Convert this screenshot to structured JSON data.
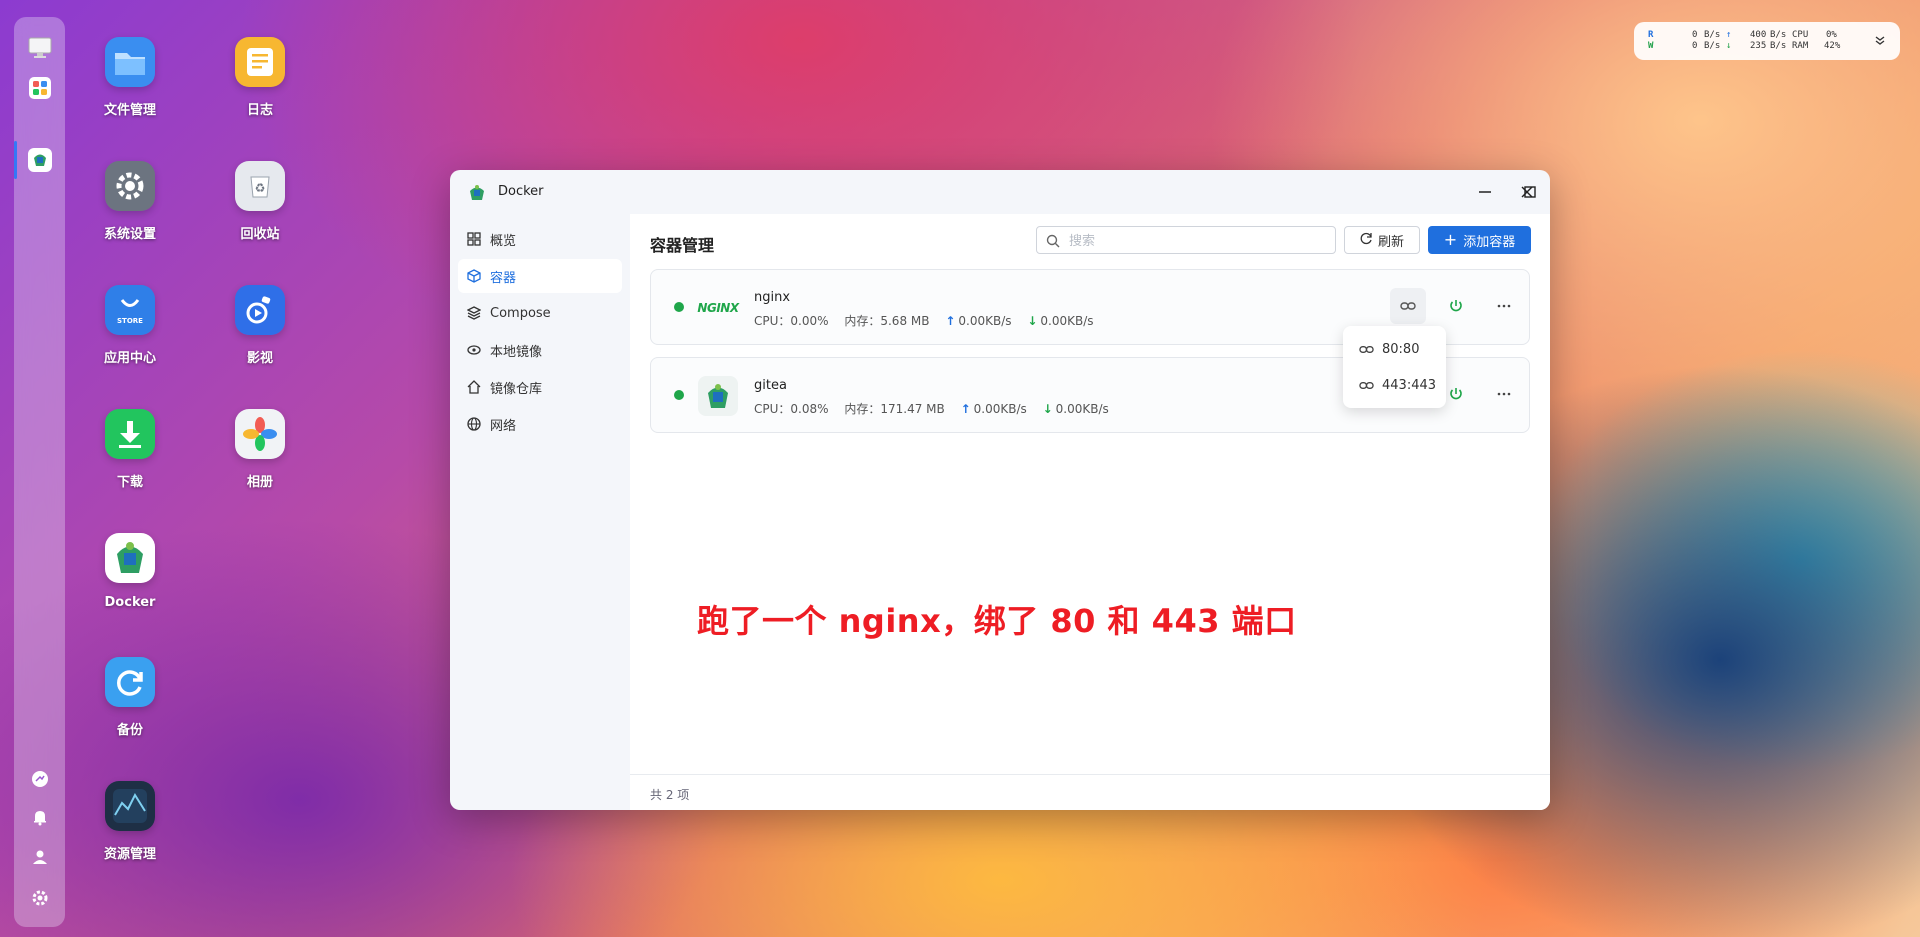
{
  "desktop": {
    "icons": [
      {
        "label": "文件管理",
        "icon": "folder-icon",
        "color": "#3a8ef0"
      },
      {
        "label": "日志",
        "icon": "log-icon",
        "color": "#f7b731"
      },
      {
        "label": "系统设置",
        "icon": "gear-icon",
        "color": "#6c7480"
      },
      {
        "label": "回收站",
        "icon": "recycle-bin-icon",
        "color": "#e6e9ee"
      },
      {
        "label": "应用中心",
        "icon": "store-icon",
        "color": "#2f7fe8"
      },
      {
        "label": "影视",
        "icon": "video-icon",
        "color": "#2f6fe8"
      },
      {
        "label": "下载",
        "icon": "download-icon",
        "color": "#22c55e"
      },
      {
        "label": "相册",
        "icon": "photos-icon",
        "color": "#f1f3f6"
      },
      {
        "label": "Docker",
        "icon": "docker-icon",
        "color": "#ffffff"
      },
      {
        "label": "备份",
        "icon": "backup-icon",
        "color": "#3aa0f0"
      },
      {
        "label": "资源管理",
        "icon": "resource-monitor-icon",
        "color": "#1e2f45"
      }
    ],
    "store_badge": "STORE"
  },
  "monitor": {
    "r_label": "R",
    "w_label": "W",
    "r_disk": "0",
    "w_disk": "0",
    "unit": "B/s",
    "up_rate": "400",
    "down_rate": "235",
    "cpu_label": "CPU",
    "ram_label": "RAM",
    "cpu_value": "0%",
    "ram_value": "42%"
  },
  "window": {
    "title": "Docker",
    "sidebar": [
      {
        "label": "概览",
        "icon": "grid-icon"
      },
      {
        "label": "容器",
        "icon": "cube-icon",
        "active": true
      },
      {
        "label": "Compose",
        "icon": "layers-icon"
      },
      {
        "label": "本地镜像",
        "icon": "disc-icon"
      },
      {
        "label": "镜像仓库",
        "icon": "home-icon"
      },
      {
        "label": "网络",
        "icon": "globe-icon"
      }
    ],
    "content_title": "容器管理",
    "search_placeholder": "搜索",
    "refresh_label": "刷新",
    "add_label": "添加容器",
    "containers": [
      {
        "name": "nginx",
        "logo_text": "NGINX",
        "cpu": "CPU：0.00%",
        "mem": "内存：5.68 MB",
        "up": "0.00KB/s",
        "down": "0.00KB/s"
      },
      {
        "name": "gitea",
        "cpu": "CPU：0.08%",
        "mem": "内存：171.47 MB",
        "up": "0.00KB/s",
        "down": "0.00KB/s"
      }
    ],
    "ports": [
      "80:80",
      "443:443"
    ],
    "footer_total": "共 2 项"
  },
  "annotation": "跑了一个 nginx，绑了 80 和 443 端口",
  "colors": {
    "accent": "#1f6fde",
    "running": "#1fa64a",
    "annotation": "#ee1d24"
  }
}
